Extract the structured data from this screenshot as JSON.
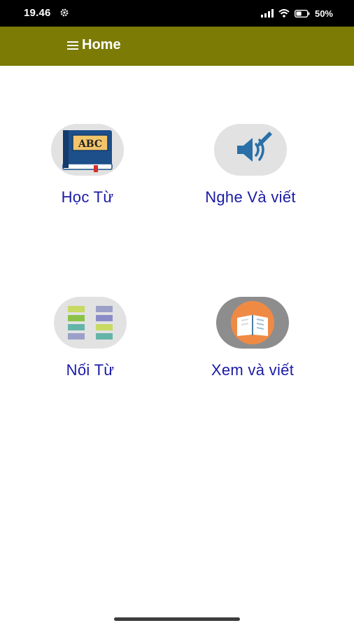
{
  "status_bar": {
    "time": "19.46",
    "battery_percent": "50%",
    "icons": [
      "gear-icon",
      "signal-icon",
      "wifi-icon",
      "battery-icon"
    ]
  },
  "app_bar": {
    "menu_icon": "hamburger-menu-icon",
    "title": "Home",
    "background": "#7b7b06"
  },
  "tiles": [
    {
      "label": "Học Từ",
      "icon": "abc-book-icon"
    },
    {
      "label": "Nghe Và viết",
      "icon": "speaker-pen-icon"
    },
    {
      "label": "Nối Từ",
      "icon": "word-grid-icon"
    },
    {
      "label": "Xem và viết",
      "icon": "open-book-icon"
    }
  ],
  "colors": {
    "label_text": "#1a1aa6",
    "icon_background": "#e2e2e2"
  }
}
